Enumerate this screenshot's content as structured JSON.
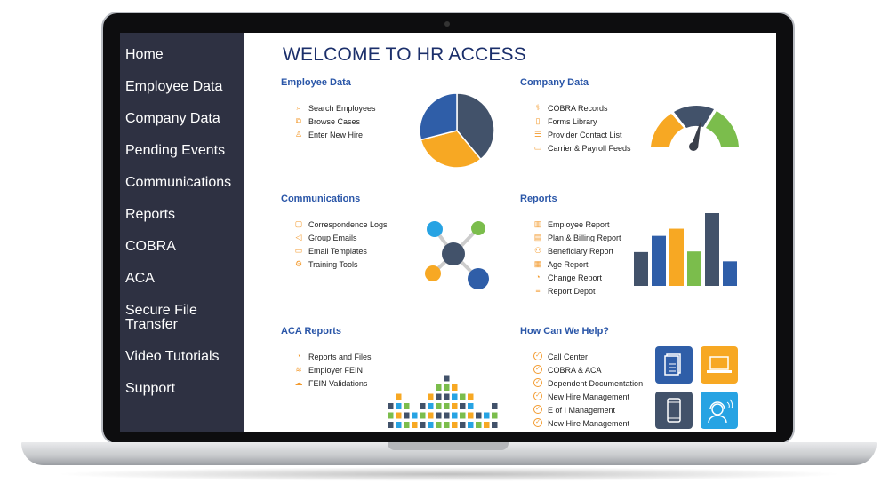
{
  "sidebar": {
    "items": [
      {
        "label": "Home"
      },
      {
        "label": "Employee Data"
      },
      {
        "label": "Company Data"
      },
      {
        "label": "Pending Events"
      },
      {
        "label": "Communications"
      },
      {
        "label": "Reports"
      },
      {
        "label": "COBRA"
      },
      {
        "label": "ACA"
      },
      {
        "label": "Secure File Transfer"
      },
      {
        "label": "Video Tutorials"
      },
      {
        "label": "Support"
      }
    ]
  },
  "main": {
    "title": "WELCOME TO HR ACCESS",
    "sections": [
      {
        "heading": "Employee Data",
        "items": [
          {
            "label": "Search Employees",
            "icon": "search-icon"
          },
          {
            "label": "Browse Cases",
            "icon": "browse-cases-icon"
          },
          {
            "label": "Enter New Hire",
            "icon": "user-icon"
          }
        ]
      },
      {
        "heading": "Company Data",
        "items": [
          {
            "label": "COBRA Records",
            "icon": "caduceus-icon"
          },
          {
            "label": "Forms Library",
            "icon": "book-icon"
          },
          {
            "label": "Provider Contact List",
            "icon": "list-icon"
          },
          {
            "label": "Carrier & Payroll Feeds",
            "icon": "briefcase-icon"
          }
        ]
      },
      {
        "heading": "Communications",
        "items": [
          {
            "label": "Correspondence Logs",
            "icon": "chat-icon"
          },
          {
            "label": "Group Emails",
            "icon": "megaphone-icon"
          },
          {
            "label": "Email Templates",
            "icon": "monitor-icon"
          },
          {
            "label": "Training Tools",
            "icon": "gear-icon"
          }
        ]
      },
      {
        "heading": "Reports",
        "items": [
          {
            "label": "Employee Report",
            "icon": "bar-chart-icon"
          },
          {
            "label": "Plan & Billing Report",
            "icon": "billing-icon"
          },
          {
            "label": "Beneficiary Report",
            "icon": "people-icon"
          },
          {
            "label": "Age Report",
            "icon": "age-chart-icon"
          },
          {
            "label": "Change Report",
            "icon": "pie-icon"
          },
          {
            "label": "Report Depot",
            "icon": "menu-icon"
          }
        ]
      },
      {
        "heading": "ACA Reports",
        "items": [
          {
            "label": "Reports and Files",
            "icon": "pie-icon"
          },
          {
            "label": "Employer FEIN",
            "icon": "stack-icon"
          },
          {
            "label": "FEIN Validations",
            "icon": "cloud-icon"
          }
        ]
      },
      {
        "heading": "How Can We Help?",
        "items": [
          {
            "label": "Call Center",
            "icon": "check-circle-icon"
          },
          {
            "label": "COBRA & ACA",
            "icon": "check-circle-icon"
          },
          {
            "label": "Dependent Documentation",
            "icon": "check-circle-icon"
          },
          {
            "label": "New Hire Management",
            "icon": "check-circle-icon"
          },
          {
            "label": "E of I Management",
            "icon": "check-circle-icon"
          },
          {
            "label": "New Hire Management",
            "icon": "check-circle-icon"
          }
        ]
      }
    ]
  },
  "colors": {
    "navy": "#1b2f6b",
    "heading": "#2a56a8",
    "accent": "#f39a2d",
    "dark": "#42526a",
    "blue": "#2f5ea8",
    "orange": "#f7a823",
    "green": "#7bbd4c",
    "lightblue": "#27a3e3",
    "sidebar": "#2e3142"
  },
  "pie_fractions": [
    0.39,
    0.32,
    0.29
  ],
  "report_bars": [
    113,
    167,
    191,
    115,
    243,
    82
  ],
  "aca_mosaic_column_heights": [
    3,
    4,
    3,
    2,
    3,
    4,
    5,
    6,
    5,
    4,
    4,
    2,
    2,
    3
  ]
}
